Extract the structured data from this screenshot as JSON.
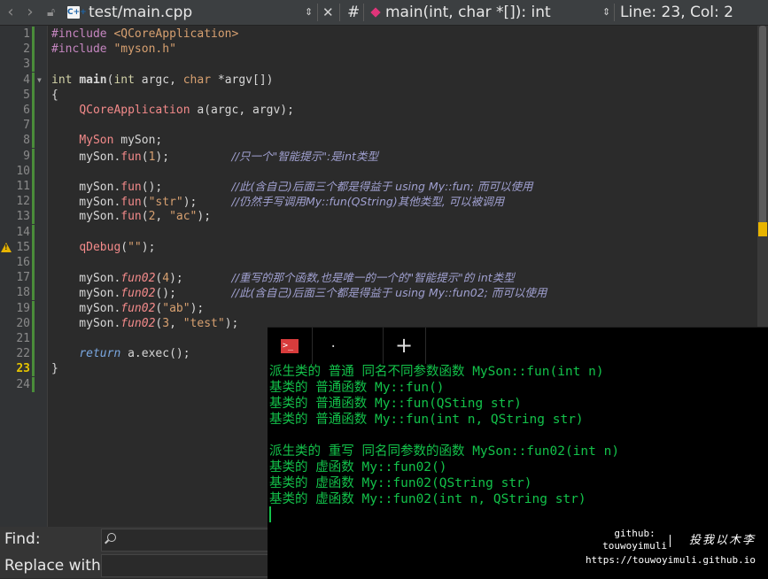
{
  "toolbar": {
    "back": "‹",
    "forward": "›",
    "file_tag": "C++",
    "file_path": "test/main.cpp",
    "updown": "⇕",
    "close": "✕",
    "hash": "#",
    "symbol": "main(int, char *[]): int",
    "position": "Line: 23, Col: 2"
  },
  "editor": {
    "current_line": 23,
    "warning_line": 15,
    "lines": [
      {
        "n": "1",
        "parts": [
          [
            "pp",
            "#include "
          ],
          [
            "str",
            "<QCoreApplication>"
          ]
        ]
      },
      {
        "n": "2",
        "parts": [
          [
            "pp",
            "#include "
          ],
          [
            "str",
            "\"myson.h\""
          ]
        ]
      },
      {
        "n": "3",
        "parts": []
      },
      {
        "n": "4",
        "parts": [
          [
            "kw",
            "int "
          ],
          [
            "fn",
            "main"
          ],
          [
            "vr",
            "("
          ],
          [
            "kw",
            "int "
          ],
          [
            "vr",
            "argc, "
          ],
          [
            "ty",
            "char "
          ],
          [
            "vr",
            "*argv[])"
          ]
        ]
      },
      {
        "n": "5",
        "parts": [
          [
            "vr",
            "{"
          ]
        ]
      },
      {
        "n": "6",
        "parts": [
          [
            "vr",
            "    "
          ],
          [
            "cls",
            "QCoreApplication"
          ],
          [
            "vr",
            " a(argc, argv);"
          ]
        ]
      },
      {
        "n": "7",
        "parts": []
      },
      {
        "n": "8",
        "parts": [
          [
            "vr",
            "    "
          ],
          [
            "cls",
            "MySon"
          ],
          [
            "vr",
            " mySon;"
          ]
        ]
      },
      {
        "n": "9",
        "parts": [
          [
            "vr",
            "    mySon."
          ],
          [
            "mem",
            "fun"
          ],
          [
            "vr",
            "("
          ],
          [
            "num",
            "1"
          ],
          [
            "vr",
            ");         "
          ],
          [
            "cm",
            "//只一个\"智能提示\":是int类型"
          ]
        ]
      },
      {
        "n": "10",
        "parts": []
      },
      {
        "n": "11",
        "parts": [
          [
            "vr",
            "    mySon."
          ],
          [
            "mem",
            "fun"
          ],
          [
            "vr",
            "();          "
          ],
          [
            "cm",
            "//此(含自己)后面三个都是得益于 using My::fun; 而可以使用"
          ]
        ]
      },
      {
        "n": "12",
        "parts": [
          [
            "vr",
            "    mySon."
          ],
          [
            "mem",
            "fun"
          ],
          [
            "vr",
            "("
          ],
          [
            "num",
            "\"str\""
          ],
          [
            "vr",
            ");     "
          ],
          [
            "cm",
            "//仍然手写调用My::fun(QString)其他类型, 可以被调用"
          ]
        ]
      },
      {
        "n": "13",
        "parts": [
          [
            "vr",
            "    mySon."
          ],
          [
            "mem",
            "fun"
          ],
          [
            "vr",
            "("
          ],
          [
            "num",
            "2"
          ],
          [
            "vr",
            ", "
          ],
          [
            "num",
            "\"ac\""
          ],
          [
            "vr",
            ");"
          ]
        ]
      },
      {
        "n": "14",
        "parts": []
      },
      {
        "n": "15",
        "parts": [
          [
            "vr",
            "    "
          ],
          [
            "mem",
            "qDebug"
          ],
          [
            "vr",
            "("
          ],
          [
            "num",
            "\"\""
          ],
          [
            "vr",
            ");"
          ]
        ]
      },
      {
        "n": "16",
        "parts": []
      },
      {
        "n": "17",
        "parts": [
          [
            "vr",
            "    mySon."
          ],
          [
            "virt",
            "fun02"
          ],
          [
            "vr",
            "("
          ],
          [
            "num",
            "4"
          ],
          [
            "vr",
            ");       "
          ],
          [
            "cm",
            "//重写的那个函数,也是唯一的一个的\"智能提示\"的 int类型"
          ]
        ]
      },
      {
        "n": "18",
        "parts": [
          [
            "vr",
            "    mySon."
          ],
          [
            "virt",
            "fun02"
          ],
          [
            "vr",
            "();        "
          ],
          [
            "cm",
            "//此(含自己)后面三个都是得益于 using My::fun02; 而可以使用"
          ]
        ]
      },
      {
        "n": "19",
        "parts": [
          [
            "vr",
            "    mySon."
          ],
          [
            "virt",
            "fun02"
          ],
          [
            "vr",
            "("
          ],
          [
            "num",
            "\"ab\""
          ],
          [
            "vr",
            ");"
          ]
        ]
      },
      {
        "n": "20",
        "parts": [
          [
            "vr",
            "    mySon."
          ],
          [
            "virt",
            "fun02"
          ],
          [
            "vr",
            "("
          ],
          [
            "num",
            "3"
          ],
          [
            "vr",
            ", "
          ],
          [
            "num",
            "\"test\""
          ],
          [
            "vr",
            ");"
          ]
        ]
      },
      {
        "n": "21",
        "parts": []
      },
      {
        "n": "22",
        "parts": [
          [
            "vr",
            "    "
          ],
          [
            "ret",
            "return"
          ],
          [
            "vr",
            " a.exec();"
          ]
        ]
      },
      {
        "n": "23",
        "parts": [
          [
            "vr",
            "}"
          ]
        ]
      },
      {
        "n": "24",
        "parts": []
      }
    ]
  },
  "findbar": {
    "find_label": "Find:",
    "replace_label": "Replace with:"
  },
  "terminal": {
    "tab_icon": ">_",
    "tab2_label": ".",
    "new_tab": "+",
    "lines": [
      "派生类的 普通 同名不同参数函数 MySon::fun(int n)",
      "基类的 普通函数 My::fun()",
      "基类的 普通函数 My::fun(QSting str)",
      "基类的 普通函数 My::fun(int n, QString str)",
      "",
      "派生类的 重写 同名同参数的函数 MySon::fun02(int n)",
      "基类的 虚函数 My::fun02()",
      "基类的 虚函数 My::fun02(QString str)",
      "基类的 虚函数 My::fun02(int n, QString str)"
    ],
    "credit": {
      "github_label": "github:\ntouwoyimuli",
      "signature": "投我以木李",
      "url": "https://touwoyimuli.github.io"
    }
  },
  "colors": {
    "terminal_text": "#13c24a",
    "warning": "#e8b400"
  }
}
